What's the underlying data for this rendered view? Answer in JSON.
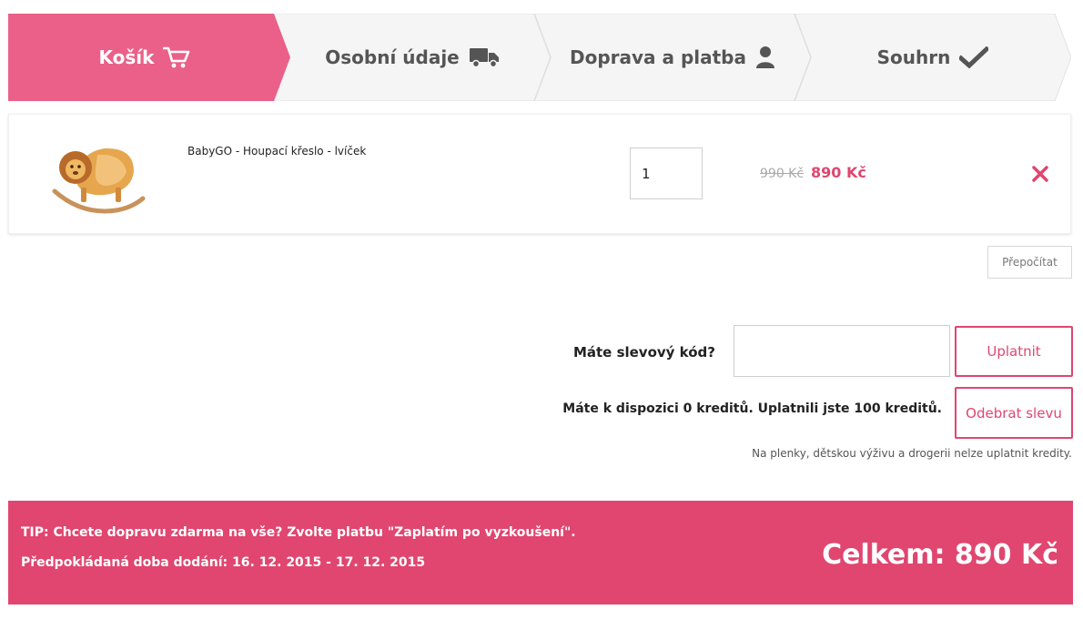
{
  "stepper": {
    "steps": [
      {
        "label": "Košík",
        "icon": "cart-icon",
        "active": true
      },
      {
        "label": "Osobní údaje",
        "icon": "truck-icon",
        "active": false
      },
      {
        "label": "Doprava a platba",
        "icon": "user-icon",
        "active": false
      },
      {
        "label": "Souhrn",
        "icon": "checkmark-icon",
        "active": false
      }
    ],
    "active_color": "#ea6088",
    "inactive_color": "#f5f5f5"
  },
  "cart": {
    "items": [
      {
        "name": "BabyGO - Houpací křeslo - lvíček",
        "quantity": "1",
        "price_old": "990 Kč",
        "price_new": "890 Kč",
        "image": "rocking-lion-chair"
      }
    ],
    "recalculate_label": "Přepočítat"
  },
  "discount": {
    "label": "Máte slevový kód?",
    "input_value": "",
    "apply_label": "Uplatnit",
    "credits_text": "Máte k dispozici 0 kreditů. Uplatnili jste 100 kreditů.",
    "remove_label": "Odebrat slevu",
    "note": "Na plenky, dětskou výživu a drogerii nelze uplatnit kredity."
  },
  "summary": {
    "tip": "TIP: Chcete dopravu zdarma na vše? Zvolte platbu \"Zaplatím po vyzkoušení\".",
    "delivery": "Předpokládaná doba dodání: 16. 12. 2015 - 17. 12. 2015",
    "total": "Celkem: 890 Kč"
  },
  "colors": {
    "accent": "#e0466f",
    "stepper_active": "#ea6088"
  }
}
